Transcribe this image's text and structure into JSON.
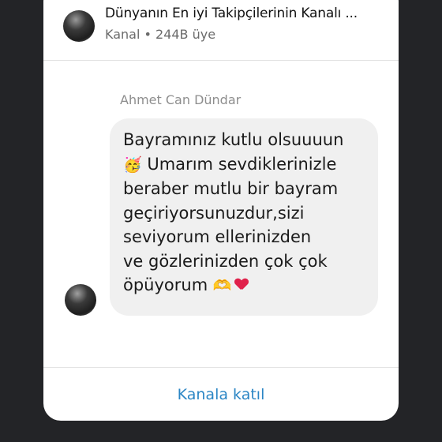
{
  "channel": {
    "title": "Dünyanın En iyi Takipçilerinin Kanalı ...",
    "subtitle": "Kanal • 244B üye"
  },
  "message": {
    "sender": "Ahmet Can Dündar",
    "lines": [
      "Bayramınız kutlu olsuuuun",
      "Umarım sevdiklerinizle",
      "beraber mutlu bir bayram",
      "geçiriyorsunuzdur,sizi",
      "seviyorum ellerinizden",
      "ve gözlerinizden çok çok",
      "öpüyorum"
    ],
    "emojis": {
      "party_face": "🥳",
      "heart_hands": "🫶"
    }
  },
  "actions": {
    "join_label": "Kanala katıl"
  },
  "colors": {
    "background": "#232427",
    "card": "#ffffff",
    "bubble": "#f0f0f0",
    "link": "#2b86c5",
    "heart": "#e0224b"
  }
}
